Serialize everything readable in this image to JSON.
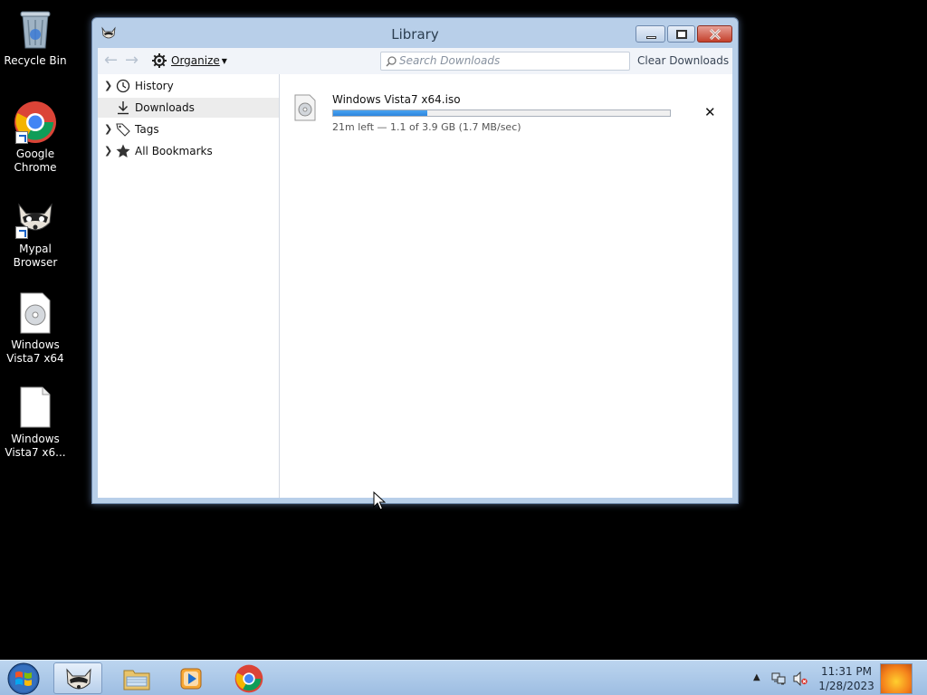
{
  "desktop": {
    "icons": [
      {
        "label": "Recycle Bin"
      },
      {
        "label": "Google Chrome"
      },
      {
        "label": "Mypal Browser"
      },
      {
        "label": "Windows Vista7 x64"
      },
      {
        "label": "Windows Vista7 x6..."
      }
    ]
  },
  "window": {
    "title": "Library",
    "toolbar": {
      "organize_label": "Organize",
      "search_placeholder": "Search Downloads",
      "clear_label": "Clear Downloads"
    },
    "sidebar": {
      "items": [
        {
          "label": "History",
          "icon": "clock-icon",
          "expandable": true
        },
        {
          "label": "Downloads",
          "icon": "download-icon",
          "expandable": false,
          "selected": true
        },
        {
          "label": "Tags",
          "icon": "tag-icon",
          "expandable": true
        },
        {
          "label": "All Bookmarks",
          "icon": "star-icon",
          "expandable": true
        }
      ]
    },
    "downloads": [
      {
        "file_name": "Windows Vista7 x64.iso",
        "status": "21m left — 1.1 of 3.9 GB (1.7 MB/sec)",
        "progress_fraction": 0.28
      }
    ]
  },
  "taskbar": {
    "clock_time": "11:31 PM",
    "clock_date": "1/28/2023"
  },
  "colors": {
    "progress_fill": "#2d86de",
    "window_frame": "#b8cfe9",
    "taskbar": "#9dbde2"
  }
}
